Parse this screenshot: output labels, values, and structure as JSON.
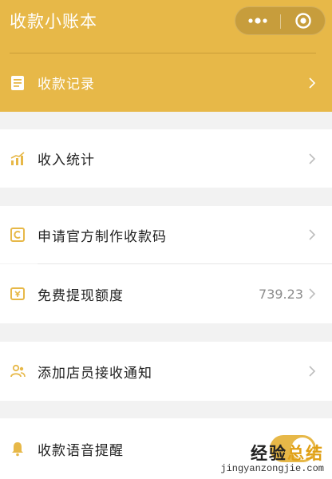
{
  "app": {
    "title": "收款小账本"
  },
  "capsule": {
    "more_icon": "more-dots-icon",
    "close_icon": "target-close-icon"
  },
  "header_item": {
    "label": "收款记录",
    "icon": "document-icon"
  },
  "menu": {
    "income_stats": {
      "label": "收入统计",
      "icon": "bar-chart-icon"
    },
    "apply_qrcode": {
      "label": "申请官方制作收款码",
      "icon": "qrcode-apply-icon"
    },
    "free_withdraw": {
      "label": "免费提现额度",
      "value": "739.23",
      "icon": "wallet-icon"
    },
    "add_clerk": {
      "label": "添加店员接收通知",
      "icon": "clerk-icon"
    },
    "voice_alert": {
      "label": "收款语音提醒",
      "icon": "bell-icon",
      "toggle_on": true
    }
  },
  "colors": {
    "brand": "#e7b848",
    "background": "#f2f2f2",
    "text": "#1f1f1f",
    "muted": "#8c8c8c"
  },
  "watermark": {
    "main_prefix": "经验",
    "main_accent": "总结",
    "sub": "jingyanzongjie.com"
  }
}
